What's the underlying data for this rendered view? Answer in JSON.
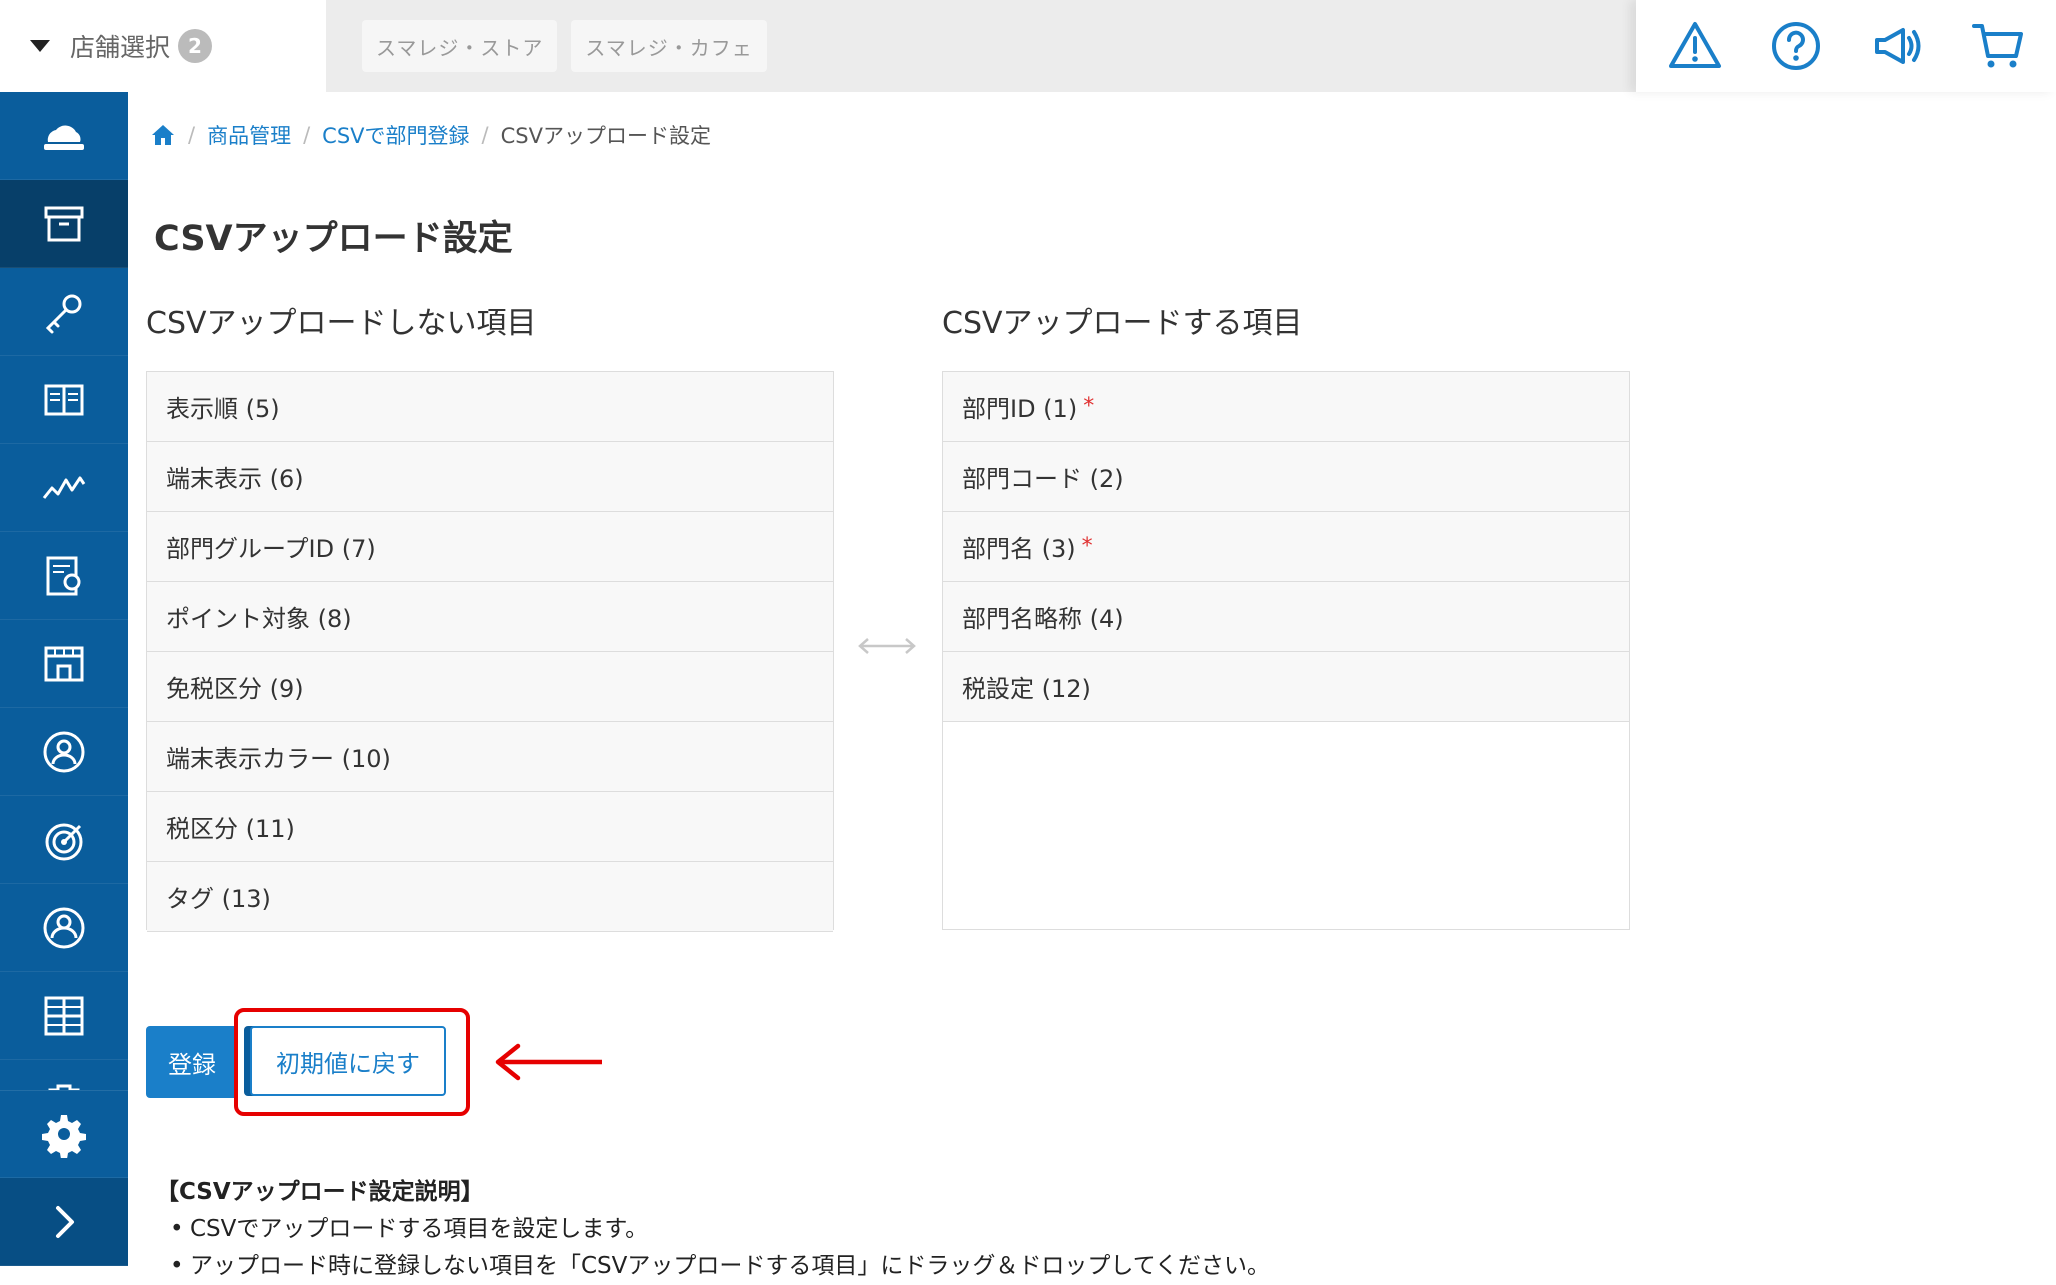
{
  "header": {
    "store_select": {
      "label": "店舗選択",
      "count": "2"
    },
    "store_tabs": [
      "スマレジ・ストア",
      "スマレジ・カフェ"
    ],
    "icons": [
      "warning-icon",
      "help-icon",
      "megaphone-icon",
      "cart-icon"
    ]
  },
  "sidenav": {
    "items": [
      "cloud-register-icon",
      "product-box-icon",
      "key-icon",
      "ledger-book-icon",
      "analytics-chart-icon",
      "report-icon",
      "store-icon",
      "staff-icon",
      "target-icon",
      "customer-icon",
      "apps-grid-icon",
      "clipboard-icon"
    ],
    "bottom": [
      "gear-icon",
      "expand-chevron-icon"
    ]
  },
  "breadcrumb": {
    "home_icon": "home-icon",
    "items": [
      "商品管理",
      "CSVで部門登録"
    ],
    "current": "CSVアップロード設定"
  },
  "page": {
    "title": "CSVアップロード設定",
    "excluded_title": "CSVアップロードしない項目",
    "included_title": "CSVアップロードする項目",
    "excluded_items": [
      {
        "label": "表示順 (5)"
      },
      {
        "label": "端末表示 (6)"
      },
      {
        "label": "部門グループID (7)"
      },
      {
        "label": "ポイント対象 (8)"
      },
      {
        "label": "免税区分 (9)"
      },
      {
        "label": "端末表示カラー (10)"
      },
      {
        "label": "税区分 (11)"
      },
      {
        "label": "タグ (13)"
      }
    ],
    "included_items": [
      {
        "label": "部門ID (1)",
        "required": "*"
      },
      {
        "label": "部門コード (2)",
        "required": ""
      },
      {
        "label": "部門名 (3)",
        "required": "*"
      },
      {
        "label": "部門名略称 (4)",
        "required": ""
      },
      {
        "label": "税設定 (12)",
        "required": ""
      }
    ],
    "swap_icon": "swap-arrows-icon",
    "buttons": {
      "submit": "登録",
      "reset": "初期値に戻す"
    },
    "description": {
      "heading": "【CSVアップロード設定説明】",
      "bullets": [
        "CSVでアップロードする項目を設定します。",
        "アップロード時に登録しない項目を「CSVアップロードする項目」にドラッグ＆ドロップしてください。"
      ]
    }
  },
  "colors": {
    "nav_bg": "#0a5d9c",
    "nav_active": "#073f69",
    "accent": "#1a7fc9",
    "highlight": "#e60000"
  }
}
